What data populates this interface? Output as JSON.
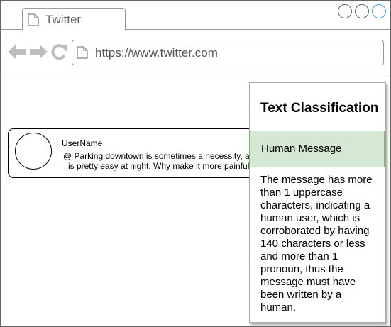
{
  "browser": {
    "tab_title": "Twitter",
    "url": "https://www.twitter.com"
  },
  "tweet": {
    "username": "UserName",
    "message_line1": "@ Parking downtown is sometimes a necessity, and",
    "message_line2": "is pretty easy at night. Why make it more painful?"
  },
  "panel": {
    "title": "Text Classification",
    "result": "Human Message",
    "result_color": "#d5e8d4",
    "explanation": "The message has more than 1 uppercase characters, indicating a human user, which is corroborated by having 140 characters or less and more than 1 pronoun, thus the message must have been written by a human."
  }
}
